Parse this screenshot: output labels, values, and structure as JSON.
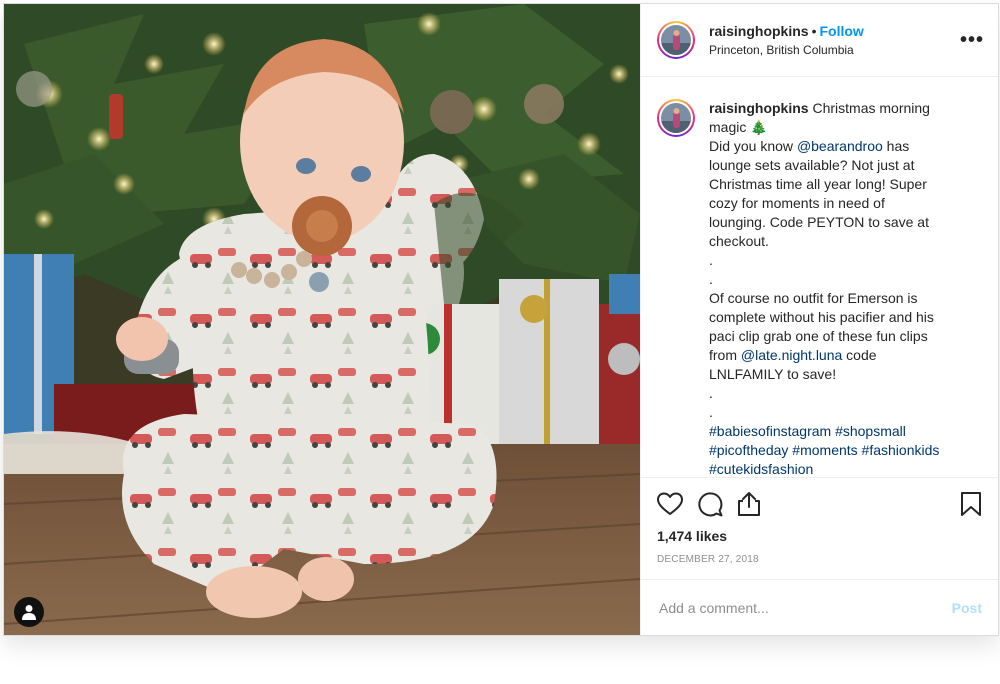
{
  "post": {
    "image_alt": "",
    "user_tag_icon": "user-silhouette-icon"
  },
  "header": {
    "username": "raisinghopkins",
    "separator": "•",
    "follow_label": "Follow",
    "location": "Princeton, British Columbia",
    "more_label": "•••"
  },
  "caption": {
    "username": "raisinghopkins",
    "line1": "Christmas morning magic 🎄",
    "line2_pre": "Did you know ",
    "line2_mention": "@bearandroo",
    "line2_post": " has lounge sets available? Not just at Christmas time all year long! Super cozy for moments in need of lounging. Code PEYTON to save at checkout.",
    "dot1": ".",
    "dot2": ".",
    "line3_pre": "Of course no outfit for Emerson is complete without his pacifier and his paci clip grab one of these fun clips from ",
    "line3_mention": "@late.night.luna",
    "line3_post": " code LNLFAMILY to save!",
    "dot3": ".",
    "dot4": ".",
    "hashtags": [
      "#babiesofinstagram",
      "#shopsmall",
      "#picoftheday",
      "#moments",
      "#fashionkids",
      "#cutekidsfashion"
    ]
  },
  "actions": {
    "like_icon": "heart-icon",
    "comment_icon": "comment-bubble-icon",
    "share_icon": "share-upload-icon",
    "save_icon": "bookmark-icon",
    "likes": "1,474 likes",
    "date": "DECEMBER 27, 2018"
  },
  "comment_box": {
    "placeholder": "Add a comment...",
    "post_label": "Post"
  },
  "colors": {
    "link": "#0095f6",
    "mention": "#00376b",
    "post_disabled": "#b2dffc",
    "muted": "#8e8e8e"
  }
}
